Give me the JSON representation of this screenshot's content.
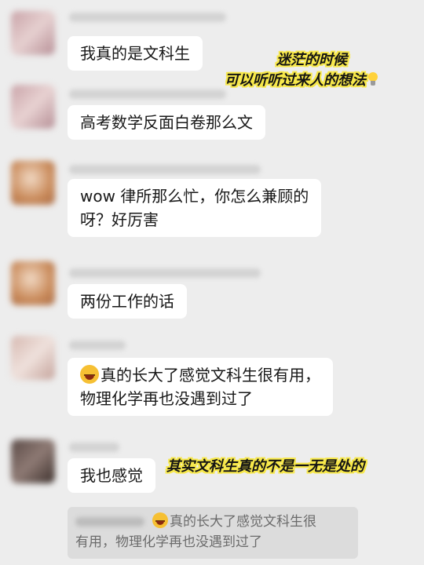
{
  "messages": [
    {
      "lines": [
        "我真的是文科生"
      ]
    },
    {
      "lines": [
        "高考数学反面白卷那么文"
      ]
    },
    {
      "lines": [
        "wow 律所那么忙，你怎么兼顾的",
        "呀？好厉害"
      ]
    },
    {
      "lines": [
        "两份工作的话"
      ]
    },
    {
      "emoji": "laughing-crying-emoji",
      "lines": [
        "真的长大了感觉文科生很有用，",
        "物理化学再也没遇到过了"
      ]
    },
    {
      "lines": [
        "我也感觉"
      ]
    }
  ],
  "quote": {
    "emoji": "laughing-crying-emoji",
    "line1": "真的长大了感觉文科生很",
    "line2": "有用，物理化学再也没遇到过了"
  },
  "overlays": {
    "top_line1": "迷茫的时候",
    "top_line2": "可以听听过来人的想法",
    "top_icon": "lightbulb-icon",
    "bottom": "其实文科生真的不是一无是处的",
    "text_color": "#141414",
    "outline_color": "#f7e84a"
  },
  "colors": {
    "background": "#ededed",
    "bubble": "#ffffff",
    "quote_bg": "#dcdcdc"
  }
}
